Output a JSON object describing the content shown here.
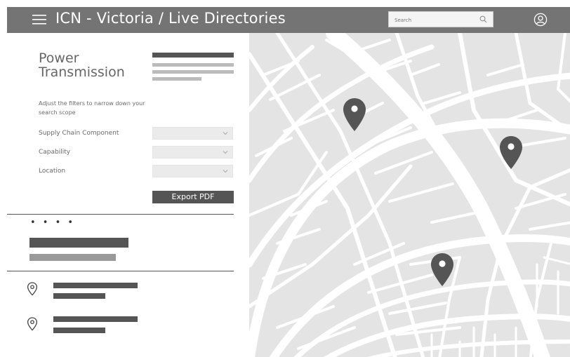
{
  "header": {
    "title": "ICN - Victoria  /  Live Directories",
    "search_placeholder": "Search",
    "menu_icon": "hamburger-menu-icon",
    "search_icon": "search-icon",
    "account_icon": "user-account-icon"
  },
  "panel": {
    "title": "Power Transmission",
    "hint": "Adjust the filters to narrow down your search scope",
    "filters": [
      {
        "label": "Supply Chain Component"
      },
      {
        "label": "Capability"
      },
      {
        "label": "Location"
      }
    ],
    "export_label": "Export PDF",
    "result_menu": "• • • •"
  },
  "map": {
    "markers": 3,
    "marker_icon": "map-pin-icon"
  }
}
